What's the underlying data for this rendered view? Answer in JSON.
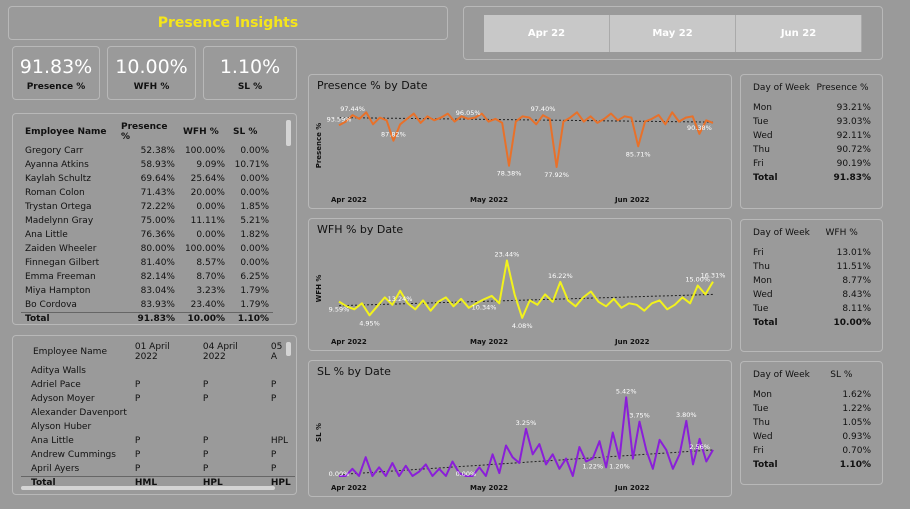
{
  "title": "Presence Insights",
  "kpis": [
    {
      "value": "91.83%",
      "label": "Presence %"
    },
    {
      "value": "10.00%",
      "label": "WFH %"
    },
    {
      "value": "1.10%",
      "label": "SL %"
    }
  ],
  "months": [
    "Apr 22",
    "May 22",
    "Jun 22"
  ],
  "employee_table": {
    "headers": [
      "Employee Name",
      "Presence %",
      "WFH %",
      "SL %"
    ],
    "rows": [
      [
        "Gregory Carr",
        "52.38%",
        "100.00%",
        "0.00%"
      ],
      [
        "Ayanna Atkins",
        "58.93%",
        "9.09%",
        "10.71%"
      ],
      [
        "Kaylah Schultz",
        "69.64%",
        "25.64%",
        "0.00%"
      ],
      [
        "Roman Colon",
        "71.43%",
        "20.00%",
        "0.00%"
      ],
      [
        "Trystan Ortega",
        "72.22%",
        "0.00%",
        "1.85%"
      ],
      [
        "Madelynn Gray",
        "75.00%",
        "11.11%",
        "5.21%"
      ],
      [
        "Ana Little",
        "76.36%",
        "0.00%",
        "1.82%"
      ],
      [
        "Zaiden Wheeler",
        "80.00%",
        "100.00%",
        "0.00%"
      ],
      [
        "Finnegan Gilbert",
        "81.40%",
        "8.57%",
        "0.00%"
      ],
      [
        "Emma Freeman",
        "82.14%",
        "8.70%",
        "6.25%"
      ],
      [
        "Miya Hampton",
        "83.04%",
        "3.23%",
        "1.79%"
      ],
      [
        "Bo Cordova",
        "83.93%",
        "23.40%",
        "1.79%"
      ]
    ],
    "total": [
      "Total",
      "91.83%",
      "10.00%",
      "1.10%"
    ]
  },
  "attendance_table": {
    "headers": [
      "Employee Name",
      "01 April 2022",
      "04 April 2022",
      "05 A"
    ],
    "rows": [
      [
        "Aditya Walls",
        "",
        "",
        ""
      ],
      [
        "Adriel Pace",
        "P",
        "P",
        "P"
      ],
      [
        "Adyson Moyer",
        "P",
        "P",
        "P"
      ],
      [
        "Alexander Davenport",
        "",
        "",
        ""
      ],
      [
        "Alyson Huber",
        "",
        "",
        ""
      ],
      [
        "Ana Little",
        "P",
        "P",
        "HPL"
      ],
      [
        "Andrew Cummings",
        "P",
        "P",
        "P"
      ],
      [
        "April Ayers",
        "P",
        "P",
        "P"
      ]
    ],
    "total": [
      "Total",
      "HML",
      "HPL",
      "HPL"
    ]
  },
  "chart_data": [
    {
      "type": "line",
      "title": "Presence % by Date",
      "ylabel": "Presence %",
      "x_ticks": [
        "Apr 2022",
        "May 2022",
        "Jun 2022"
      ],
      "ylim": [
        70,
        102
      ],
      "color": "#e8712a",
      "values": [
        93.59,
        95.0,
        97.44,
        96.0,
        98.5,
        94.0,
        96.5,
        95.5,
        87.82,
        94.0,
        96.0,
        98.0,
        94.5,
        97.0,
        95.5,
        96.5,
        98.0,
        95.0,
        97.0,
        96.05,
        96.5,
        98.0,
        95.0,
        96.0,
        94.5,
        78.38,
        95.0,
        97.0,
        96.5,
        94.0,
        97.4,
        96.0,
        77.92,
        95.0,
        96.5,
        98.5,
        95.0,
        97.0,
        94.5,
        96.0,
        98.0,
        95.5,
        97.0,
        96.5,
        85.71,
        95.0,
        96.0,
        97.5,
        94.0,
        98.5,
        95.0,
        96.5,
        97.0,
        90.38,
        95.5,
        94.5
      ],
      "labels": [
        {
          "i": 0,
          "text": "93.59%"
        },
        {
          "i": 2,
          "text": "97.44%"
        },
        {
          "i": 8,
          "text": "87.82%"
        },
        {
          "i": 19,
          "text": "96.05%"
        },
        {
          "i": 25,
          "text": "78.38%"
        },
        {
          "i": 30,
          "text": "97.40%"
        },
        {
          "i": 32,
          "text": "77.92%"
        },
        {
          "i": 44,
          "text": "85.71%"
        },
        {
          "i": 53,
          "text": "90.38%"
        }
      ],
      "trend": [
        96.5,
        94.8
      ]
    },
    {
      "type": "line",
      "title": "WFH % by Date",
      "ylabel": "WFH %",
      "x_ticks": [
        "Apr 2022",
        "May 2022",
        "Jun 2022"
      ],
      "ylim": [
        0,
        28
      ],
      "color": "#f2f21c",
      "values": [
        9.59,
        8.0,
        7.0,
        9.0,
        4.95,
        8.0,
        11.0,
        8.5,
        13.24,
        9.0,
        7.0,
        10.0,
        6.5,
        9.5,
        11.0,
        8.0,
        10.5,
        7.5,
        9.0,
        10.34,
        11.5,
        9.0,
        23.44,
        12.0,
        4.08,
        10.0,
        8.5,
        12.0,
        9.5,
        16.22,
        10.0,
        8.0,
        11.0,
        13.0,
        9.5,
        8.0,
        10.5,
        7.5,
        9.0,
        8.5,
        6.5,
        9.0,
        10.0,
        7.0,
        8.5,
        11.0,
        9.0,
        15.0,
        12.0,
        16.31
      ],
      "labels": [
        {
          "i": 0,
          "text": "9.59%"
        },
        {
          "i": 4,
          "text": "4.95%"
        },
        {
          "i": 8,
          "text": "13.24%"
        },
        {
          "i": 19,
          "text": "10.34%"
        },
        {
          "i": 22,
          "text": "23.44%"
        },
        {
          "i": 24,
          "text": "4.08%"
        },
        {
          "i": 29,
          "text": "16.22%"
        },
        {
          "i": 47,
          "text": "15.00%"
        },
        {
          "i": 49,
          "text": "16.31%"
        }
      ],
      "trend": [
        8.2,
        12.0
      ]
    },
    {
      "type": "line",
      "title": "SL % by Date",
      "ylabel": "SL %",
      "x_ticks": [
        "Apr 2022",
        "May 2022",
        "Jun 2022"
      ],
      "ylim": [
        0,
        6
      ],
      "color": "#8a1fd8",
      "values": [
        0.0,
        0.0,
        0.5,
        0.0,
        1.3,
        0.0,
        0.6,
        0.0,
        0.9,
        0.0,
        0.7,
        0.0,
        0.3,
        0.8,
        0.0,
        0.5,
        0.0,
        1.0,
        0.2,
        0.0,
        0.0,
        0.6,
        0.0,
        1.5,
        0.2,
        2.1,
        1.3,
        0.9,
        3.25,
        1.5,
        2.2,
        0.8,
        1.5,
        0.5,
        1.2,
        0.0,
        2.0,
        1.0,
        1.22,
        2.4,
        0.6,
        3.0,
        1.2,
        5.42,
        1.2,
        3.75,
        1.8,
        0.5,
        2.5,
        1.8,
        0.5,
        1.5,
        3.8,
        0.8,
        2.56,
        1.0,
        1.8
      ],
      "labels": [
        {
          "i": 0,
          "text": "0.00%"
        },
        {
          "i": 19,
          "text": "0.00%"
        },
        {
          "i": 28,
          "text": "3.25%"
        },
        {
          "i": 38,
          "text": "1.22%"
        },
        {
          "i": 42,
          "text": "1.20%"
        },
        {
          "i": 43,
          "text": "5.42%"
        },
        {
          "i": 45,
          "text": "3.75%"
        },
        {
          "i": 52,
          "text": "3.80%"
        },
        {
          "i": 54,
          "text": "2.56%"
        }
      ],
      "trend": [
        0.1,
        1.8
      ]
    }
  ],
  "dow_tables": [
    {
      "col1": "Day of Week",
      "col2": "Presence %",
      "rows": [
        [
          "Mon",
          "93.21%"
        ],
        [
          "Tue",
          "93.03%"
        ],
        [
          "Wed",
          "92.11%"
        ],
        [
          "Thu",
          "90.72%"
        ],
        [
          "Fri",
          "90.19%"
        ]
      ],
      "total": [
        "Total",
        "91.83%"
      ]
    },
    {
      "col1": "Day of Week",
      "col2": "WFH %",
      "rows": [
        [
          "Fri",
          "13.01%"
        ],
        [
          "Thu",
          "11.51%"
        ],
        [
          "Mon",
          "8.77%"
        ],
        [
          "Wed",
          "8.43%"
        ],
        [
          "Tue",
          "8.11%"
        ]
      ],
      "total": [
        "Total",
        "10.00%"
      ]
    },
    {
      "col1": "Day of Week",
      "col2": "SL %",
      "rows": [
        [
          "Mon",
          "1.62%"
        ],
        [
          "Tue",
          "1.22%"
        ],
        [
          "Thu",
          "1.05%"
        ],
        [
          "Wed",
          "0.93%"
        ],
        [
          "Fri",
          "0.70%"
        ]
      ],
      "total": [
        "Total",
        "1.10%"
      ]
    }
  ]
}
